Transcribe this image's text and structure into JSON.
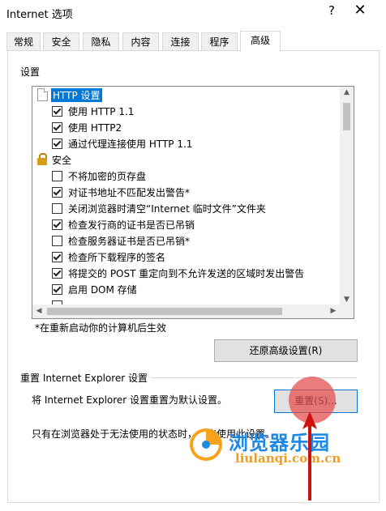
{
  "window": {
    "title": "Internet 选项",
    "help_label": "?",
    "close_label": "✕"
  },
  "tabs": [
    {
      "label": "常规"
    },
    {
      "label": "安全"
    },
    {
      "label": "隐私"
    },
    {
      "label": "内容"
    },
    {
      "label": "连接"
    },
    {
      "label": "程序"
    },
    {
      "label": "高级",
      "active": true
    }
  ],
  "settings": {
    "group_label": "设置",
    "items": [
      {
        "type": "header",
        "icon": "page-icon",
        "label": "HTTP 设置",
        "selected": true
      },
      {
        "type": "checkbox",
        "checked": true,
        "label": "使用 HTTP 1.1"
      },
      {
        "type": "checkbox",
        "checked": true,
        "label": "使用 HTTP2"
      },
      {
        "type": "checkbox",
        "checked": true,
        "label": "通过代理连接使用 HTTP 1.1"
      },
      {
        "type": "header",
        "icon": "lock-icon",
        "label": "安全"
      },
      {
        "type": "checkbox",
        "checked": false,
        "label": "不将加密的页存盘"
      },
      {
        "type": "checkbox",
        "checked": true,
        "label": "对证书地址不匹配发出警告*"
      },
      {
        "type": "checkbox",
        "checked": false,
        "label": "关闭浏览器时清空“Internet 临时文件”文件夹"
      },
      {
        "type": "checkbox",
        "checked": true,
        "label": "检查发行商的证书是否已吊销"
      },
      {
        "type": "checkbox",
        "checked": false,
        "label": "检查服务器证书是否已吊销*"
      },
      {
        "type": "checkbox",
        "checked": true,
        "label": "检查所下载程序的签名"
      },
      {
        "type": "checkbox",
        "checked": true,
        "label": "将提交的 POST 重定向到不允许发送的区域时发出警告"
      },
      {
        "type": "checkbox",
        "checked": true,
        "label": "启用 DOM 存储"
      }
    ],
    "restart_note": "*在重新启动你的计算机后生效",
    "restore_button": "还原高级设置(R)"
  },
  "reset": {
    "group_label": "重置 Internet Explorer 设置",
    "description": "将 Internet Explorer 设置重置为默认设置。",
    "reset_button": "重置(S)...",
    "note": "只有在浏览器处于无法使用的状态时，才应使用此设置。"
  },
  "watermark": {
    "title": "浏览器乐园",
    "url": "liulanqi.com.cn"
  },
  "colors": {
    "selection": "#0078d7",
    "highlight": "#e65050",
    "arrow": "#cc1111",
    "watermark_blue": "#1e88e5",
    "watermark_orange": "#f29c1f"
  }
}
